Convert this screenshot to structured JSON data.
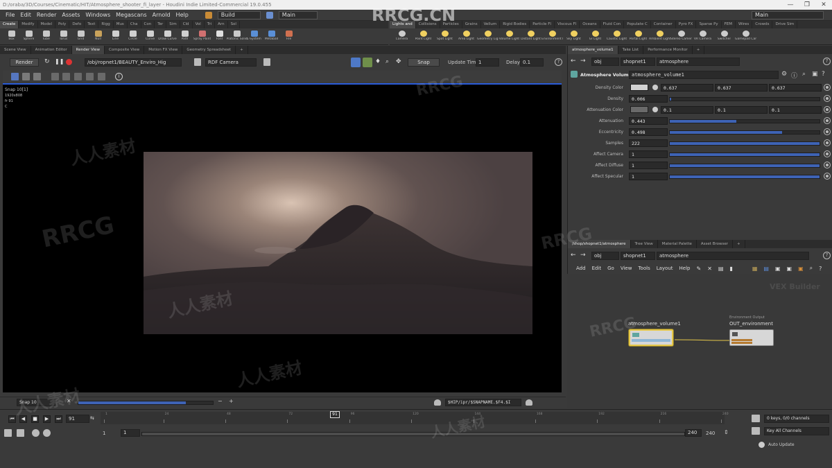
{
  "window": {
    "title": "D:/oraba/3D/Courses/Cinematic/HIT/Atmosphere_shooter_fi_layer - Houdini Indie Limited-Commercial 19.0.455",
    "controls": [
      "—",
      "❐",
      "✕"
    ]
  },
  "menu": {
    "items": [
      "File",
      "Edit",
      "Render",
      "Assets",
      "Windows",
      "Megascans",
      "Arnold",
      "Help"
    ],
    "build_desk": "Build",
    "main_desk": "Main",
    "right_desk": "Main"
  },
  "shelf_tabs_left": [
    "Create",
    "Modify",
    "Model",
    "Poly",
    "Defo",
    "Text",
    "Rigg",
    "Mus",
    "Cha",
    "Con",
    "Ter",
    "Sim",
    "Cld",
    "Vol",
    "Tri",
    "Arn",
    "Sol"
  ],
  "shelf_tabs_right": [
    "Lights and",
    "Collisions",
    "Particles",
    "Grains",
    "Vellum",
    "Rigid Bodies",
    "Particle Fl",
    "Viscous Fl",
    "Oceans",
    "Fluid Con",
    "Populate C",
    "Container",
    "Pyro FX",
    "Sparse Py",
    "FEM",
    "Wires",
    "Crowds",
    "Drive Sim"
  ],
  "shelf_tools_left": [
    {
      "label": "Box",
      "color": "#c9c9c9"
    },
    {
      "label": "Sphere",
      "color": "#c9c9c9"
    },
    {
      "label": "Tube",
      "color": "#c9c9c9"
    },
    {
      "label": "Torus",
      "color": "#c9c9c9"
    },
    {
      "label": "Grid",
      "color": "#c9c9c9"
    },
    {
      "label": "Null",
      "color": "#c9a25b"
    },
    {
      "label": "Line",
      "color": "#d0d0d0"
    },
    {
      "label": "Circle",
      "color": "#d0d0d0"
    },
    {
      "label": "Curve",
      "color": "#d0d0d0"
    },
    {
      "label": "Draw Curve",
      "color": "#d0d0d0"
    },
    {
      "label": "Path",
      "color": "#d0d0d0"
    },
    {
      "label": "Spray Paint",
      "color": "#d07070"
    },
    {
      "label": "Font",
      "color": "#e0e0e0"
    },
    {
      "label": "Platonic Solids",
      "color": "#c9c9c9"
    },
    {
      "label": "L-System",
      "color": "#5a8fd6"
    },
    {
      "label": "Metaball",
      "color": "#5a8fd6"
    },
    {
      "label": "File",
      "color": "#d07050"
    }
  ],
  "shelf_tools_right": [
    {
      "label": "Camera",
      "color": "#cccccc"
    },
    {
      "label": "Point Light",
      "color": "#f0d060"
    },
    {
      "label": "Spot Light",
      "color": "#f0d060"
    },
    {
      "label": "Area Light",
      "color": "#f0d060"
    },
    {
      "label": "Geometry Light",
      "color": "#f0d060"
    },
    {
      "label": "Volume Light",
      "color": "#f0d060"
    },
    {
      "label": "Distant Light",
      "color": "#f0d060"
    },
    {
      "label": "Environment Light",
      "color": "#f0d060"
    },
    {
      "label": "Sky Light",
      "color": "#f0d060"
    },
    {
      "label": "GI Light",
      "color": "#f0d060"
    },
    {
      "label": "Caustic Light",
      "color": "#f0d060"
    },
    {
      "label": "Portal Light",
      "color": "#f0d060"
    },
    {
      "label": "Ambient Light",
      "color": "#f0d060"
    },
    {
      "label": "Stereo Camera",
      "color": "#cccccc"
    },
    {
      "label": "VR Camera",
      "color": "#cccccc"
    },
    {
      "label": "Switcher",
      "color": "#cccccc"
    },
    {
      "label": "Gamepad Camera",
      "color": "#cccccc"
    }
  ],
  "left_pane_tabs": [
    "Scene View",
    "Animation Editor",
    "Render View",
    "Composite View",
    "Motion FX View",
    "Geometry Spreadsheet"
  ],
  "render_view": {
    "render_button": "Render",
    "rop_path": "/obj/ropnet1/BEAUTY_Enviro_Hig",
    "camera": "RDF Camera",
    "snap_button": "Snap",
    "update_time_label": "Update Time",
    "update_time_value": "1",
    "delay_label": "Delay",
    "delay_value": "0.1",
    "overlay_lines": [
      "Snap 10[1]",
      "1920x808",
      "fr 91",
      "C"
    ],
    "snap_selector": "Snap 10",
    "image_path": "$HIP/ipr/$SNAPNAME.$F4.$I"
  },
  "right_pane_tabs": [
    "atmosphere_volume1",
    "Take List",
    "Performance Monitor"
  ],
  "params": {
    "path": [
      "obj",
      "shopnet1",
      "atmosphere"
    ],
    "node_type": "Atmosphere Volume",
    "node_name": "atmosphere_volume1",
    "rows": [
      {
        "label": "Density Color",
        "values": [
          "0.637",
          "0.637",
          "0.637"
        ],
        "swatch": "#d2d2d2"
      },
      {
        "label": "Density",
        "value": "0.006",
        "fraction": 0.01
      },
      {
        "label": "Attenuation Color",
        "values": [
          "0.1",
          "0.1",
          "0.1"
        ],
        "swatch": "#6a6a6a"
      },
      {
        "label": "Attenuation",
        "value": "0.443",
        "fraction": 0.443
      },
      {
        "label": "Eccentricity",
        "value": "0.498",
        "fraction": 0.75
      },
      {
        "label": "Samples",
        "value": "222",
        "fraction": 1.0
      },
      {
        "label": "Affect Camera",
        "value": "1",
        "fraction": 1.0
      },
      {
        "label": "Affect Diffuse",
        "value": "1",
        "fraction": 1.0
      },
      {
        "label": "Affect Specular",
        "value": "1",
        "fraction": 1.0
      }
    ]
  },
  "network": {
    "tabs": [
      "/shop/shopnet1/atmosphere",
      "Tree View",
      "Material Palette",
      "Asset Browser"
    ],
    "path": [
      "obj",
      "shopnet1",
      "atmosphere"
    ],
    "menu": [
      "Add",
      "Edit",
      "Go",
      "View",
      "Tools",
      "Layout",
      "Help"
    ],
    "context_label": "VEX Builder",
    "node_a": "atmosphere_volume1",
    "node_b_type": "Environment Output",
    "node_b": "OUT_environment"
  },
  "timeline": {
    "current_frame": "91",
    "marker": "91",
    "start": "1",
    "start2": "1",
    "end": "240",
    "end2": "240",
    "ticks": [
      "1",
      "24",
      "48",
      "72",
      "96",
      "120",
      "144",
      "168",
      "192",
      "216",
      "240"
    ],
    "keys_info": "0 keys, 0/0 channels",
    "key_all": "Key All Channels",
    "auto_update": "Auto Update"
  },
  "watermarks": [
    "RRCG.CN",
    "RRCG",
    "人人素材",
    "RRCG",
    "人人素材",
    "RRCG",
    "人人素材",
    "人人素材",
    "RRCG",
    "人人素材"
  ]
}
